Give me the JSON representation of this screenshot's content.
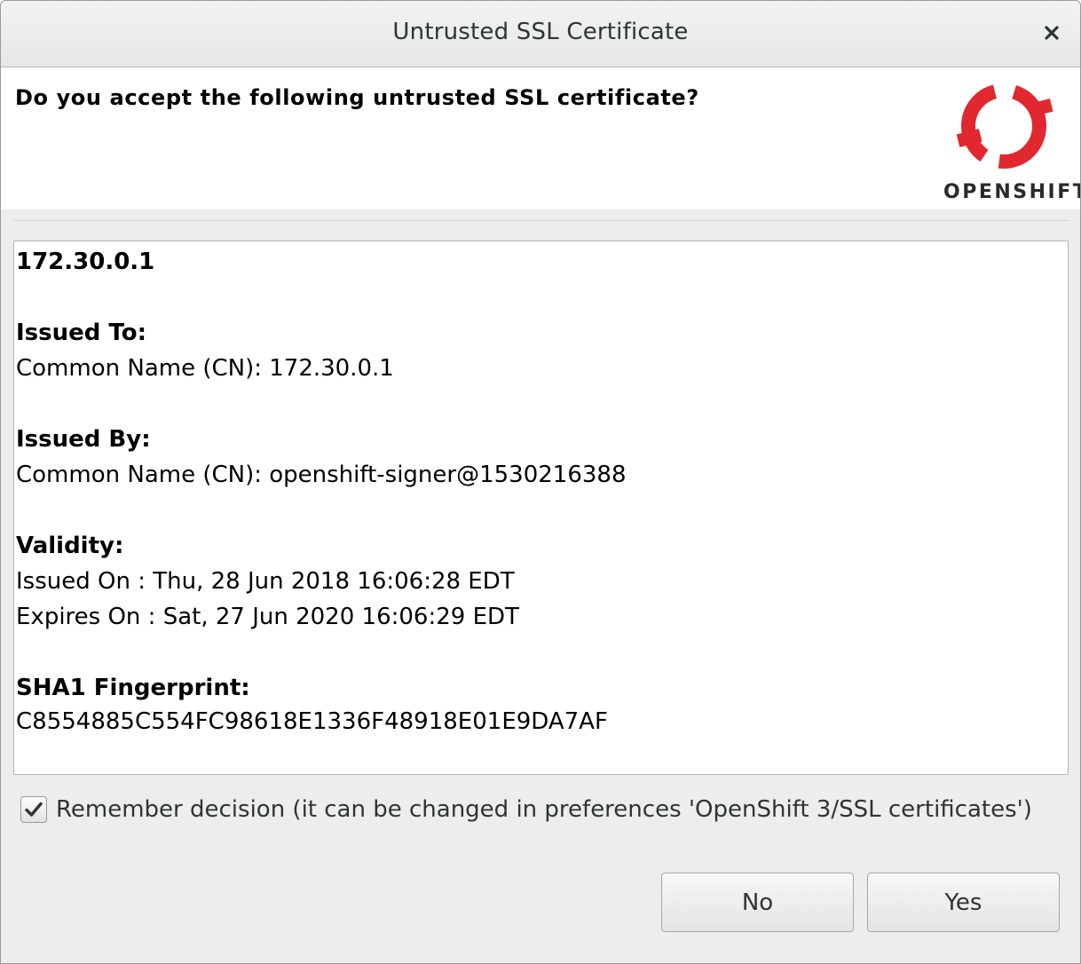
{
  "window": {
    "title": "Untrusted SSL Certificate",
    "close_icon": "close-icon"
  },
  "header": {
    "question": "Do you accept the following untrusted SSL certificate?",
    "logo_text": "OPENSHIFT",
    "logo_color": "#e0282e"
  },
  "certificate": {
    "host": "172.30.0.1",
    "issued_to_heading": "Issued To:",
    "issued_to_cn": "Common Name (CN): 172.30.0.1",
    "issued_by_heading": "Issued By:",
    "issued_by_cn": "Common Name (CN): openshift-signer@1530216388",
    "validity_heading": "Validity:",
    "issued_on": "Issued On : Thu, 28 Jun 2018 16:06:28 EDT",
    "expires_on": "Expires On : Sat, 27 Jun 2020 16:06:29 EDT",
    "fingerprint_heading": "SHA1 Fingerprint:",
    "fingerprint": "C8554885C554FC98618E1336F48918E01E9DA7AF"
  },
  "remember": {
    "checked": true,
    "label": "Remember decision (it can be changed in preferences 'OpenShift 3/SSL certificates')"
  },
  "buttons": {
    "no_label": "No",
    "yes_label": "Yes"
  }
}
